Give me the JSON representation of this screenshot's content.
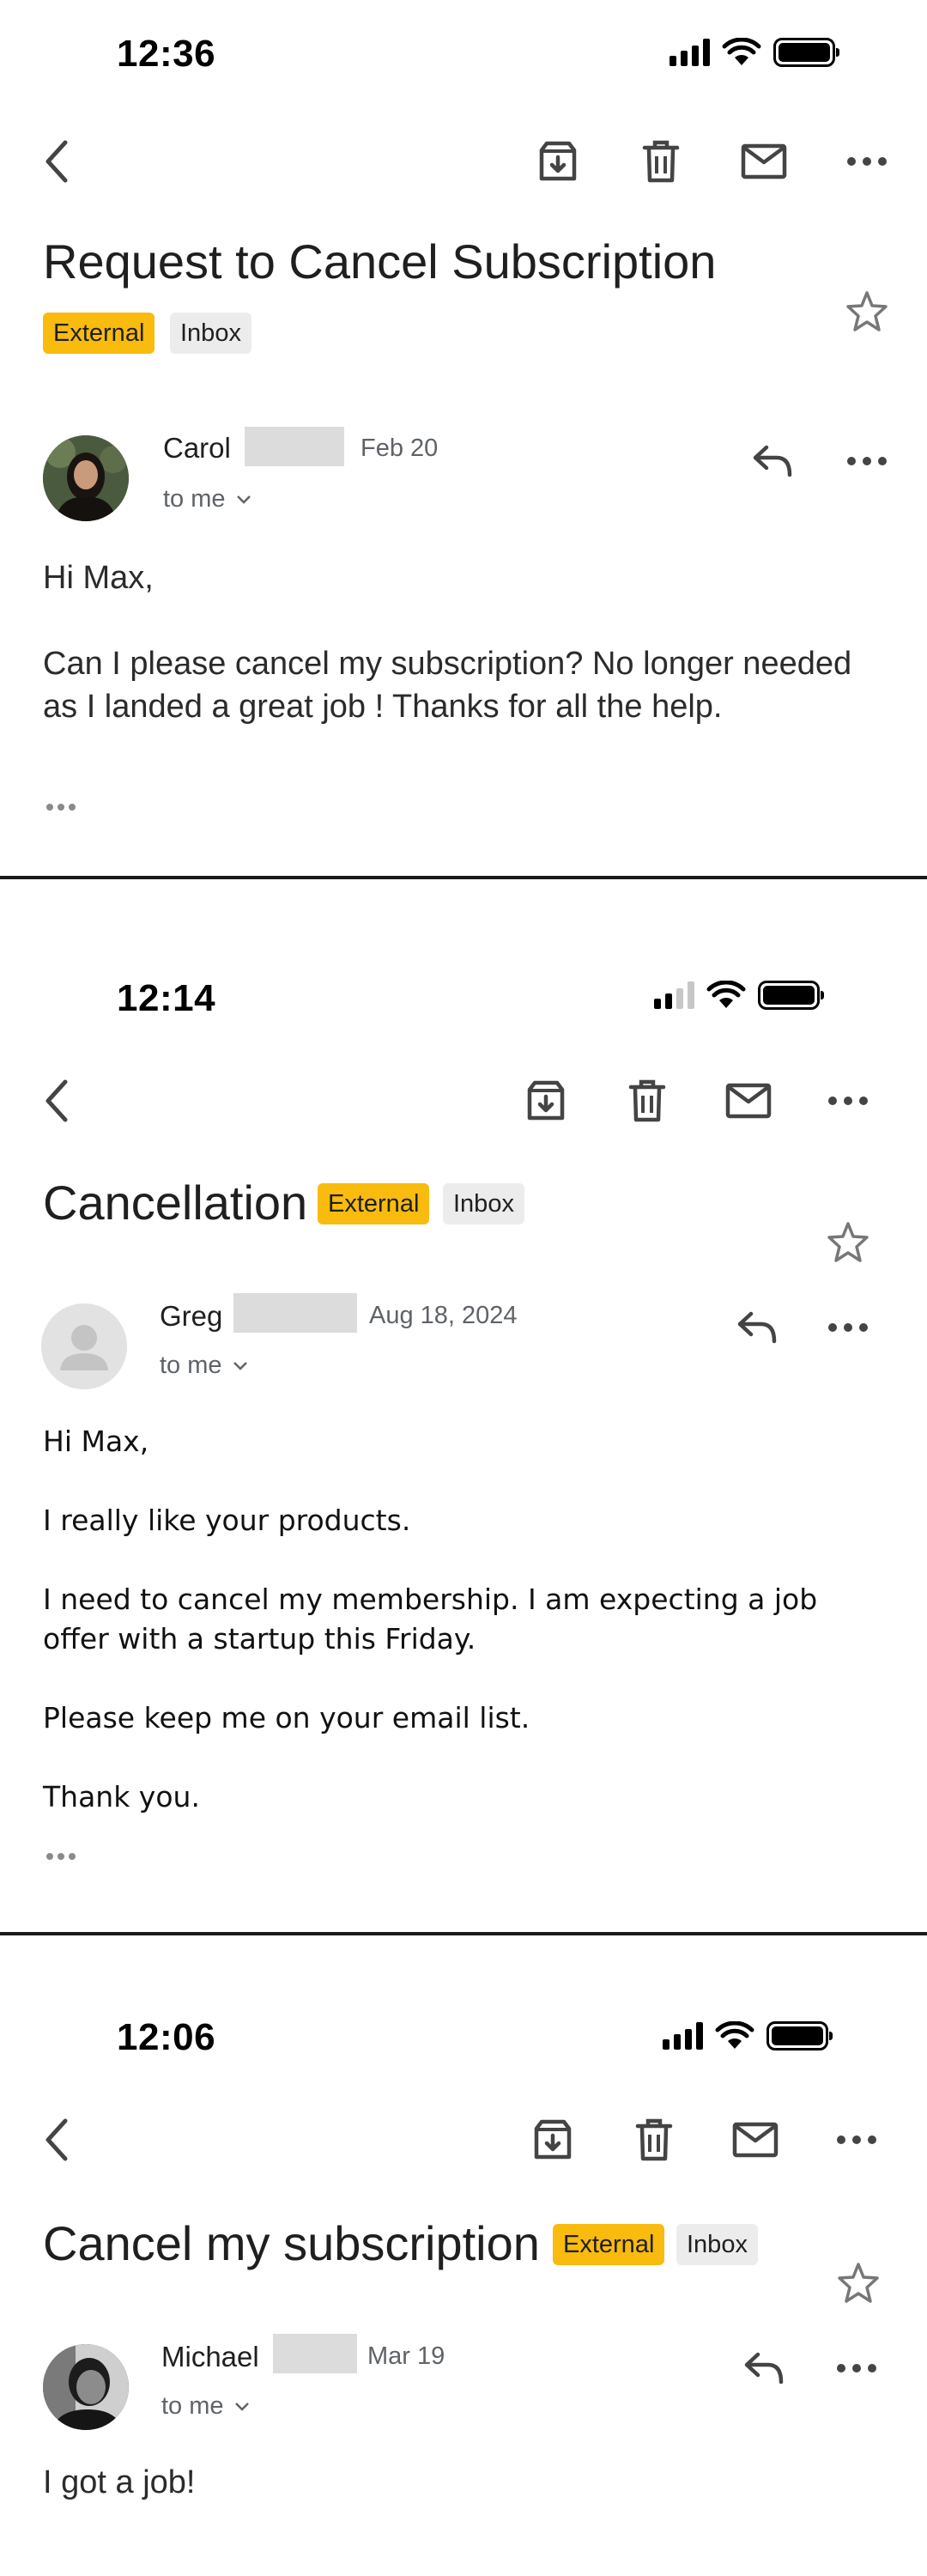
{
  "emails": [
    {
      "status_time": "12:36",
      "subject": "Request to Cancel Subscription",
      "chip_external": "External",
      "chip_inbox": "Inbox",
      "sender": "Carol",
      "date": "Feb 20",
      "to": "to me",
      "body": [
        "Hi Max,",
        "Can I please cancel my subscription? No longer needed as I landed a great job ! Thanks for all the help."
      ]
    },
    {
      "status_time": "12:14",
      "subject": "Cancellation",
      "chip_external": "External",
      "chip_inbox": "Inbox",
      "sender": "Greg",
      "date": "Aug 18, 2024",
      "to": "to me",
      "body": [
        "Hi Max,",
        "I really like your products.",
        "I need to cancel my membership.  I am expecting a job offer with a startup this Friday.",
        "Please keep me on your email list.",
        "Thank you."
      ]
    },
    {
      "status_time": "12:06",
      "subject": "Cancel my subscription",
      "chip_external": "External",
      "chip_inbox": "Inbox",
      "sender": "Michael",
      "date": "Mar 19",
      "to": "to me",
      "body": [
        "I got a job!"
      ]
    }
  ],
  "icons": [
    "back-arrow-icon",
    "archive-icon",
    "trash-icon",
    "mail-icon",
    "more-horizontal-icon",
    "star-icon",
    "reply-icon",
    "chevron-down-icon",
    "signal-icon",
    "wifi-icon",
    "battery-icon"
  ],
  "colors": {
    "external_chip": "#f8bb0e",
    "inbox_chip": "#ececec",
    "divider": "#1a1a1a"
  }
}
